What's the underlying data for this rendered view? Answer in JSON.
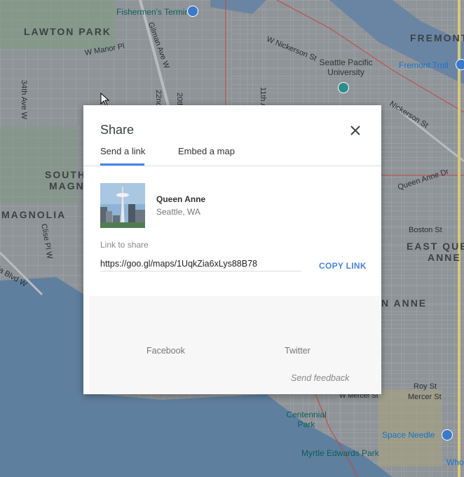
{
  "map": {
    "labels": {
      "fishermens_terminal": "Fishermen's Terminal",
      "lawton_park": "LAWTON PARK",
      "fremont": "FREMONT",
      "w_nickerson_st": "W Nickerson St",
      "seattle_pacific_university": "Seattle Pacific University",
      "fremont_troll": "Fremont Troll",
      "w_manor_pl": "W Manor Pl",
      "gilman_ave_w": "Gilman Ave W",
      "ave_22nd": "22nd",
      "ave_20th": "20th",
      "ave_11th": "11th A",
      "ave_34th": "34th Ave W",
      "nickerson_st": "Nickerson St",
      "south_magnolia_1": "SOUTH",
      "south_magnolia_2": "MAGN",
      "magnolia": "MAGNOLIA",
      "queen_anne_dr": "Queen Anne Dr",
      "boston_st": "Boston St",
      "east_queen_anne_1": "EAST QUE",
      "east_queen_anne_2": "ANNE",
      "queen_anne_fragment": "N ANNE",
      "clise_pl_w": "Clise Pl W",
      "ia_blvd_w": "ia Blvd W",
      "roy_st": "Roy St",
      "mercer_st": "Mercer St",
      "w_mercer_st": "W Mercer St",
      "centennial_park": "Centennial Park",
      "space_needle": "Space Needle",
      "myrtle_edwards_park": "Myrtle Edwards Park",
      "who": "Who"
    }
  },
  "dialog": {
    "title": "Share",
    "tabs": [
      {
        "label": "Send a link",
        "active": true
      },
      {
        "label": "Embed a map",
        "active": false
      }
    ],
    "place": {
      "name": "Queen Anne",
      "address": "Seattle, WA"
    },
    "link_label": "Link to share",
    "link_value": "https://goo.gl/maps/1UqkZia6xLys88B78",
    "copy_link_label": "COPY LINK",
    "social": {
      "facebook": "Facebook",
      "twitter": "Twitter"
    },
    "send_feedback": "Send feedback"
  },
  "colors": {
    "accent": "#4285f4",
    "copy_link": "#4a86d6",
    "water": "#5f7f9f",
    "map_land": "#8f9498",
    "park": "#7f9a7e"
  }
}
